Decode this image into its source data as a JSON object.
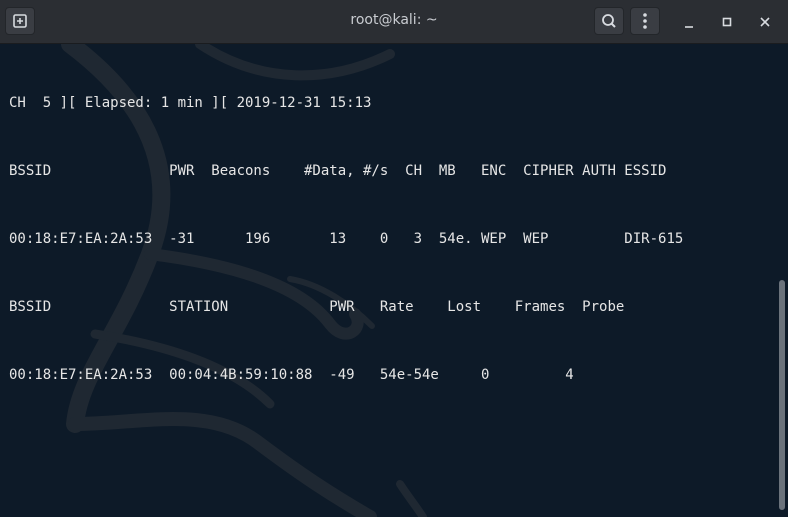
{
  "window": {
    "title": "root@kali: ~"
  },
  "terminal": {
    "lines": [
      "CH  5 ][ Elapsed: 1 min ][ 2019-12-31 15:13",
      "BSSID              PWR  Beacons    #Data, #/s  CH  MB   ENC  CIPHER AUTH ESSID",
      "00:18:E7:EA:2A:53  -31      196       13    0   3  54e. WEP  WEP         DIR-615",
      "BSSID              STATION            PWR   Rate    Lost    Frames  Probe",
      "00:18:E7:EA:2A:53  00:04:4B:59:10:88  -49   54e-54e     0         4"
    ]
  },
  "icons": {
    "new_tab": "new-tab-icon",
    "search": "search-icon",
    "menu": "kebab-menu-icon",
    "minimize": "minimize-icon",
    "maximize": "maximize-icon",
    "close": "close-icon"
  },
  "colors": {
    "titlebar": "#2b2e33",
    "terminal_bg": "#0d1a28",
    "text": "#e6e6e6"
  }
}
